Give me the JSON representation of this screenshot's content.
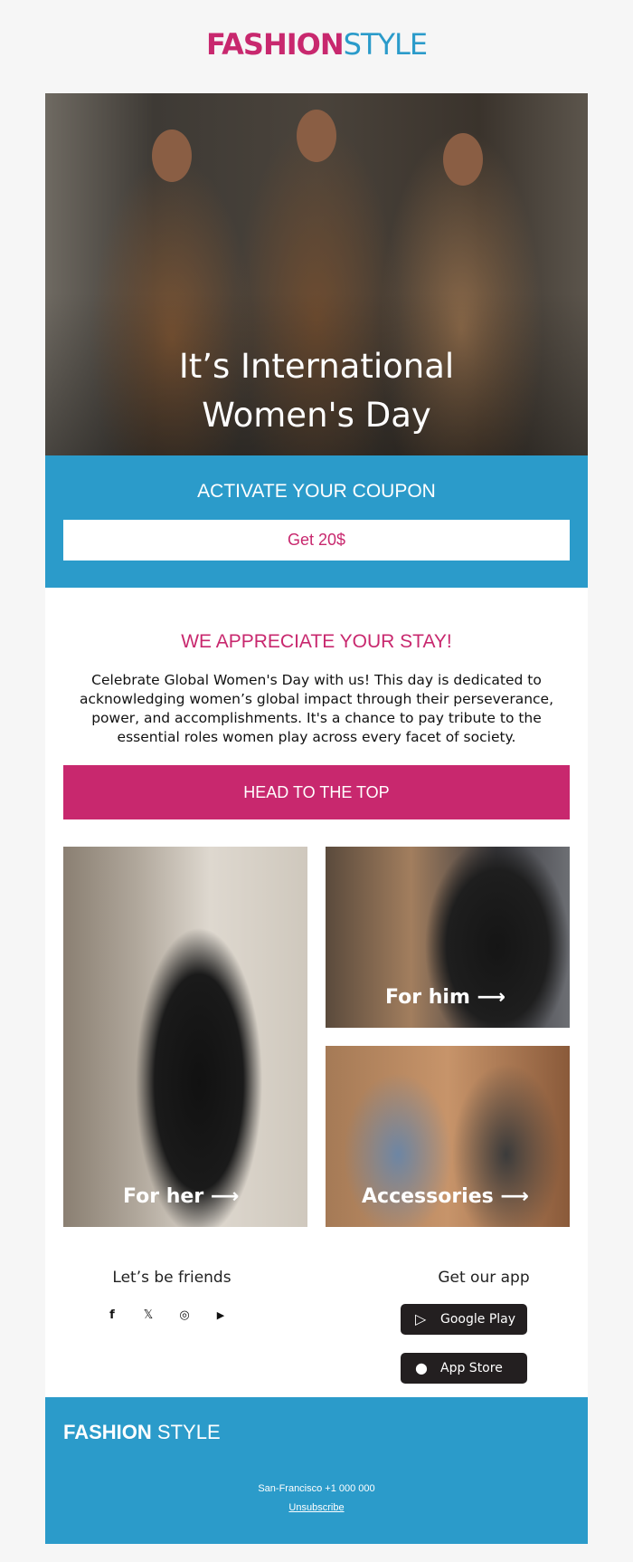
{
  "brand": {
    "part1": "FASHION",
    "part2": "STYLE"
  },
  "hero": {
    "title_line1": "It’s International",
    "title_line2": "Women's Day"
  },
  "coupon": {
    "heading": "ACTIVATE YOUR COUPON",
    "button": "Get 20$"
  },
  "message": {
    "heading": "WE APPRECIATE YOUR STAY!",
    "body": "Celebrate Global Women's Day with us! This day is dedicated to acknowledging women’s global impact through their perseverance, power, and accomplishments. It's a chance to pay tribute to the essential roles women play across every facet of society."
  },
  "cta": {
    "label": "HEAD TO THE TOP"
  },
  "tiles": {
    "her": "For her ⟶",
    "him": "For him ⟶",
    "accessories": "Accessories ⟶"
  },
  "social": {
    "heading": "Let’s be friends",
    "icons": {
      "facebook": "f",
      "x": "𝕏",
      "instagram": "◎",
      "youtube": "▶"
    }
  },
  "apps": {
    "heading": "Get our app",
    "google": "Google Play",
    "apple": "App Store"
  },
  "footer": {
    "brand1": "FASHION",
    "brand2": "STYLE",
    "address": "San-Francisco +1 000 000",
    "unsubscribe": "Unsubscribe"
  },
  "colors": {
    "pink": "#c8286e",
    "blue": "#2b9bca"
  }
}
